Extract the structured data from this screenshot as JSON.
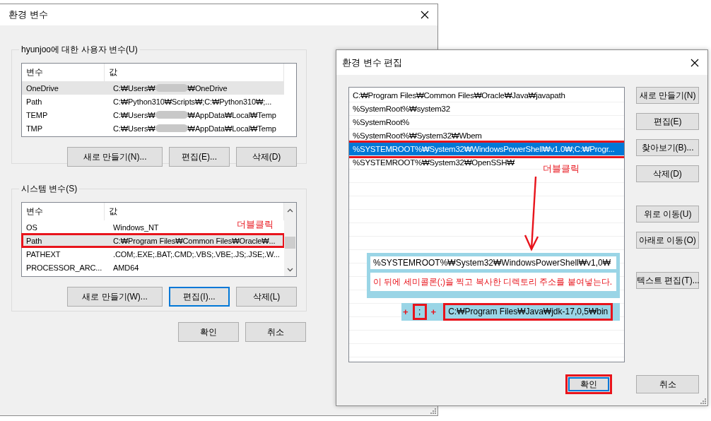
{
  "main_window": {
    "title": "환경 변수",
    "user_group": {
      "label": "hyunjoo에 대한 사용자 변수(U)",
      "columns": [
        "변수",
        "값"
      ],
      "rows": [
        {
          "name": "OneDrive",
          "value_parts": [
            "C:₩Users₩",
            "₩OneDrive"
          ],
          "selected": true,
          "highlighted": false
        },
        {
          "name": "Path",
          "value": "C:₩Python310₩Scripts₩;C:₩Python310₩;...",
          "selected": false,
          "highlighted": false
        },
        {
          "name": "TEMP",
          "value_parts": [
            "C:₩Users₩",
            "₩AppData₩Local₩Temp"
          ],
          "selected": false,
          "highlighted": false
        },
        {
          "name": "TMP",
          "value_parts": [
            "C:₩Users₩",
            "₩AppData₩Local₩Temp"
          ],
          "selected": false,
          "highlighted": false
        }
      ],
      "buttons": [
        {
          "label": "새로 만들기(N)...",
          "focused": false
        },
        {
          "label": "편집(E)...",
          "focused": false
        },
        {
          "label": "삭제(D)",
          "focused": false
        }
      ]
    },
    "system_group": {
      "label": "시스템 변수(S)",
      "columns": [
        "변수",
        "값"
      ],
      "annotation": "더블클릭",
      "rows": [
        {
          "name": "OS",
          "value": "Windows_NT",
          "selected": false,
          "highlighted": false
        },
        {
          "name": "Path",
          "value": "C:₩Program Files₩Common Files₩Oracle₩...",
          "selected": true,
          "highlighted": true
        },
        {
          "name": "PATHEXT",
          "value": ".COM;.EXE;.BAT;.CMD;.VBS;.VBE;.JS;.JSE;.W...",
          "selected": false,
          "highlighted": false
        },
        {
          "name": "PROCESSOR_ARC...",
          "value": "AMD64",
          "selected": false,
          "highlighted": false
        }
      ],
      "buttons": [
        {
          "label": "새로 만들기(W)...",
          "focused": false
        },
        {
          "label": "편집(I)...",
          "focused": true
        },
        {
          "label": "삭제(L)",
          "focused": false
        }
      ]
    },
    "buttons": [
      {
        "label": "확인",
        "focused": false,
        "highlighted": false
      },
      {
        "label": "취소",
        "focused": false,
        "highlighted": false
      }
    ]
  },
  "edit_window": {
    "title": "환경 변수 편집",
    "annotation": "더블클릭",
    "entries": [
      {
        "text": "C:₩Program Files₩Common Files₩Oracle₩Java₩javapath",
        "selected": false,
        "highlighted": false
      },
      {
        "text": "%SystemRoot%₩system32",
        "selected": false,
        "highlighted": false
      },
      {
        "text": "%SystemRoot%",
        "selected": false,
        "highlighted": false
      },
      {
        "text": "%SystemRoot%₩System32₩Wbem",
        "selected": false,
        "highlighted": false
      },
      {
        "text": "%SYSTEMROOT%₩System32₩WindowsPowerShell₩v1.0₩;C:₩Progr...",
        "selected": true,
        "highlighted": true
      },
      {
        "text": "%SYSTEMROOT%₩System32₩OpenSSH₩",
        "selected": false,
        "highlighted": false
      }
    ],
    "button_groups": [
      [
        {
          "label": "새로 만들기(N)"
        },
        {
          "label": "편집(E)"
        },
        {
          "label": "찾아보기(B)..."
        },
        {
          "label": "삭제(D)"
        }
      ],
      [
        {
          "label": "위로 이동(U)"
        },
        {
          "label": "아래로 이동(O)"
        }
      ],
      [
        {
          "label": "텍스트 편집(T)..."
        }
      ]
    ],
    "buttons": [
      {
        "label": "확인",
        "focused": true,
        "highlighted": true
      },
      {
        "label": "취소",
        "focused": false,
        "highlighted": false
      }
    ],
    "callout": {
      "path": "%SYSTEMROOT%₩System32₩WindowsPowerShell₩v1,0₩",
      "note": "이 뒤에 세미콜론(;)을 찍고 복사한 디렉토리 주소를 붙여넣는다.",
      "plus_1": "+",
      "separator": ";",
      "plus_2": "+",
      "addition": "C:₩Program Files₩Java₩jdk-17,0,5₩bin"
    }
  }
}
